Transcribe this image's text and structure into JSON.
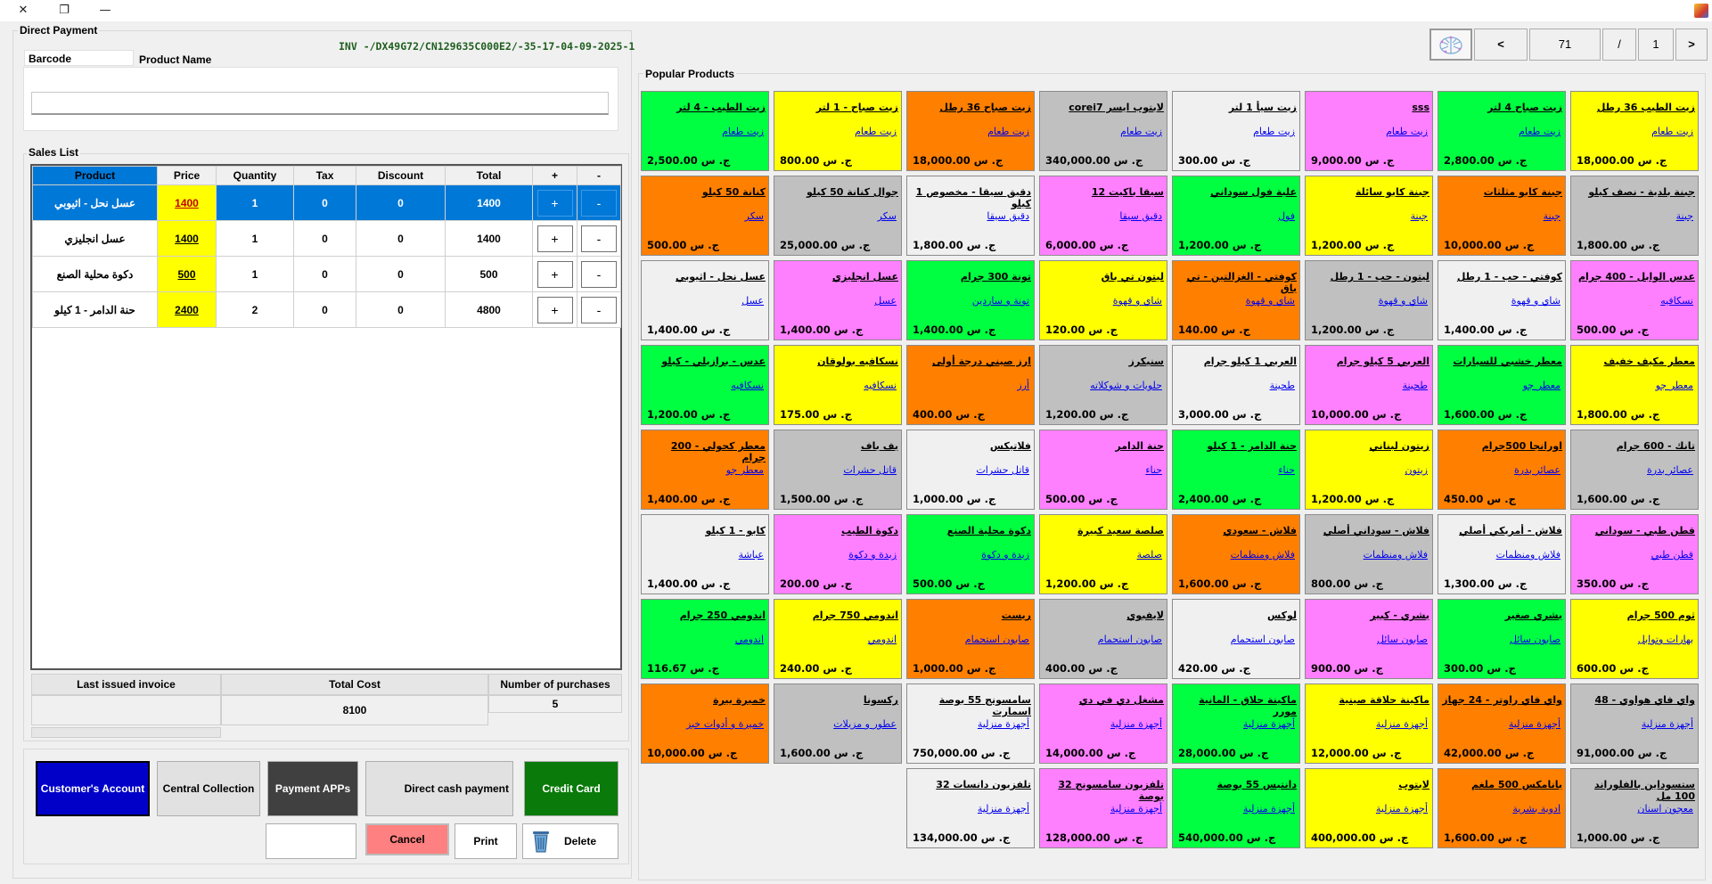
{
  "window": {
    "close_glyph": "✕",
    "restore_glyph": "❐",
    "minimize_glyph": "—"
  },
  "frame_title": "Direct Payment",
  "invoice_code": "INV -/DX49G72/CN129635C000E2/-35-17-04-09-2025-1",
  "tabs": {
    "barcode": "Barcode",
    "product_name": "Product Name"
  },
  "search": {
    "value": "",
    "placeholder": ""
  },
  "sales_list": {
    "title": "Sales List",
    "columns": [
      "Product",
      "Price",
      "Quantity",
      "Tax",
      "Discount",
      "Total",
      "+",
      "-"
    ],
    "rows": [
      {
        "product": "عسل نحل - اثيوبي",
        "price": "1400",
        "quantity": "1",
        "tax": "0",
        "discount": "0",
        "total": "1400",
        "plus": "+",
        "minus": "-"
      },
      {
        "product": "عسل انجليزي",
        "price": "1400",
        "quantity": "1",
        "tax": "0",
        "discount": "0",
        "total": "1400",
        "plus": "+",
        "minus": "-"
      },
      {
        "product": "دكوة محلية الصنع",
        "price": "500",
        "quantity": "1",
        "tax": "0",
        "discount": "0",
        "total": "500",
        "plus": "+",
        "minus": "-"
      },
      {
        "product": "حنة الدامر - 1 كيلو",
        "price": "2400",
        "quantity": "2",
        "tax": "0",
        "discount": "0",
        "total": "4800",
        "plus": "+",
        "minus": "-"
      }
    ]
  },
  "summary": {
    "last_invoice_label": "Last issued invoice",
    "last_invoice_value": "",
    "total_cost_label": "Total Cost",
    "total_cost_value": "8100",
    "purchases_label": "Number of purchases",
    "purchases_value": "5"
  },
  "buttons": {
    "customers_account": "Customer's Account",
    "central_collection": "Central Collection",
    "payment_apps": "Payment APPs",
    "direct_cash": "Direct cash payment",
    "credit_card": "Credit Card",
    "blank": "",
    "cancel": "Cancel",
    "print": "Print",
    "delete": "Delete"
  },
  "colors": {
    "selected": "#0078d7",
    "customers_account": "#0000c8",
    "payment_apps": "#404040",
    "credit_card": "#0a7a0a",
    "cancel": "#ff8080",
    "price_cell": "#ffff00"
  },
  "pager": {
    "prev": "<",
    "total": "71",
    "separator": "/",
    "current": "1",
    "next": ">",
    "logo_icon": "brain-icon"
  },
  "popular": {
    "title": "Popular Products",
    "products": [
      {
        "name": "زيت الطيب 36 رطل",
        "category": "زيت طعام",
        "price": "18,000.00 ج. س",
        "color": "#ffff00"
      },
      {
        "name": "زيت صباح 4 لتر",
        "category": "زيت طعام",
        "price": "2,800.00 ج. س",
        "color": "#00ff40"
      },
      {
        "name": "sss",
        "category": "زيت طعام",
        "price": "9,000.00 ج. س",
        "color": "#ff80ff"
      },
      {
        "name": "زيت سيأ 1 لتر",
        "category": "زيت طعام",
        "price": "300.00 ج. س",
        "color": "#f0f0f0"
      },
      {
        "name": "لابتوب ايسر corei7",
        "category": "زيت طعام",
        "price": "340,000.00 ج. س",
        "color": "#c0c0c0"
      },
      {
        "name": "زيت صباح 36 رطل",
        "category": "زيت طعام",
        "price": "18,000.00 ج. س",
        "color": "#ff8000"
      },
      {
        "name": "زيت صباح - 1 لتر",
        "category": "زيت طعام",
        "price": "800.00 ج. س",
        "color": "#ffff00"
      },
      {
        "name": "زيت الطيب - 4 لتر",
        "category": "زيت طعام",
        "price": "2,500.00 ج. س",
        "color": "#00ff40"
      },
      {
        "name": "جبنة بلدية - نصف كيلو",
        "category": "جبنة",
        "price": "1,800.00 ج. س",
        "color": "#c0c0c0"
      },
      {
        "name": "جبنة كابو مثلثات",
        "category": "جبنة",
        "price": "10,000.00 ج. س",
        "color": "#ff8000"
      },
      {
        "name": "جبنة كابو سائلة",
        "category": "جبنة",
        "price": "1,200.00 ج. س",
        "color": "#ffff00"
      },
      {
        "name": "علبة فول سوداني",
        "category": "فول",
        "price": "1,200.00 ج. س",
        "color": "#00ff40"
      },
      {
        "name": "سيقا باكيت 12",
        "category": "دقيق سيقا",
        "price": "6,000.00 ج. س",
        "color": "#ff80ff"
      },
      {
        "name": "دقيق سيقا - مخصوص 1 كيلو",
        "category": "دقيق سيقا",
        "price": "1,800.00 ج. س",
        "color": "#f0f0f0"
      },
      {
        "name": "جوال كنانة 50 كيلو",
        "category": "سكر",
        "price": "25,000.00 ج. س",
        "color": "#c0c0c0"
      },
      {
        "name": "كنانة 50 كيلو",
        "category": "سكر",
        "price": "500.00 ج. س",
        "color": "#ff8000"
      },
      {
        "name": "عدس الوابل - 400 جرام",
        "category": "نسكافيه",
        "price": "500.00 ج. س",
        "color": "#ff80ff"
      },
      {
        "name": "كوفتي - حب - 1 رطل",
        "category": "شاي و قهوة",
        "price": "1,400.00 ج. س",
        "color": "#f0f0f0"
      },
      {
        "name": "ليتون - حب - 1 رطل",
        "category": "شاي و قهوة",
        "price": "1,200.00 ج. س",
        "color": "#c0c0c0"
      },
      {
        "name": "كوفتي - الغزالتين - تي باق",
        "category": "شاي و قهوة",
        "price": "140.00 ج. س",
        "color": "#ff8000"
      },
      {
        "name": "ليتون تي باق",
        "category": "شاي و قهوة",
        "price": "120.00 ج. س",
        "color": "#ffff00"
      },
      {
        "name": "تونة 300 جرام",
        "category": "تونة و ساردين",
        "price": "1,400.00 ج. س",
        "color": "#00ff40"
      },
      {
        "name": "عسل انجليزي",
        "category": "عسل",
        "price": "1,400.00 ج. س",
        "color": "#ff80ff"
      },
      {
        "name": "عسل نحل - اثيوبي",
        "category": "عسل",
        "price": "1,400.00 ج. س",
        "color": "#f0f0f0"
      },
      {
        "name": "معطر مكيف خفيف",
        "category": "معطر جو",
        "price": "1,800.00 ج. س",
        "color": "#ffff00"
      },
      {
        "name": "معطر خشبي للسيارات",
        "category": "معطر جو",
        "price": "1,600.00 ج. س",
        "color": "#00ff40"
      },
      {
        "name": "العربي 5 كيلو جرام",
        "category": "طحينة",
        "price": "10,000.00 ج. س",
        "color": "#ff80ff"
      },
      {
        "name": "العربي 1 كيلو جرام",
        "category": "طحينة",
        "price": "3,000.00 ج. س",
        "color": "#f0f0f0"
      },
      {
        "name": "سنيكرز",
        "category": "حلويات و شوكلاته",
        "price": "1,200.00 ج. س",
        "color": "#c0c0c0"
      },
      {
        "name": "ارز صيني درجة أولى",
        "category": "أرز",
        "price": "400.00 ج. س",
        "color": "#ff8000"
      },
      {
        "name": "نسكافيه بولوقان",
        "category": "نسكافيه",
        "price": "175.00 ج. س",
        "color": "#ffff00"
      },
      {
        "name": "عدس - برازيلي - كيلو",
        "category": "نسكافيه",
        "price": "1,200.00 ج. س",
        "color": "#00ff40"
      },
      {
        "name": "تانك - 600 جرام",
        "category": "عصائر بدرة",
        "price": "1,600.00 ج. س",
        "color": "#c0c0c0"
      },
      {
        "name": "اورانجا 500جرام",
        "category": "عصائر بدرة",
        "price": "450.00 ج. س",
        "color": "#ff8000"
      },
      {
        "name": "زيتون لبناني",
        "category": "زيتون",
        "price": "1,200.00 ج. س",
        "color": "#ffff00"
      },
      {
        "name": "حنة الدامر - 1 كيلو",
        "category": "حناء",
        "price": "2,400.00 ج. س",
        "color": "#00ff40"
      },
      {
        "name": "حنة الدامر",
        "category": "حناء",
        "price": "500.00 ج. س",
        "color": "#ff80ff"
      },
      {
        "name": "فلاتيكس",
        "category": "قاتل حشرات",
        "price": "1,000.00 ج. س",
        "color": "#f0f0f0"
      },
      {
        "name": "بف باف",
        "category": "قاتل حشرات",
        "price": "1,500.00 ج. س",
        "color": "#c0c0c0"
      },
      {
        "name": "معطر كحولي - 200 جرام",
        "category": "معطر جو",
        "price": "1,400.00 ج. س",
        "color": "#ff8000"
      },
      {
        "name": "قطن طبي - سوداني",
        "category": "قطن طبي",
        "price": "350.00 ج. س",
        "color": "#ff80ff"
      },
      {
        "name": "فلاش - أمريكي أصلي",
        "category": "فلاش ومنظمات",
        "price": "1,300.00 ج. س",
        "color": "#f0f0f0"
      },
      {
        "name": "فلاش - سوداني أصلي",
        "category": "فلاش ومنظمات",
        "price": "800.00 ج. س",
        "color": "#c0c0c0"
      },
      {
        "name": "فلاش - سعودي",
        "category": "فلاش ومنظمات",
        "price": "1,600.00 ج. س",
        "color": "#ff8000"
      },
      {
        "name": "صلصة سعيد كبيرة",
        "category": "صلصة",
        "price": "1,200.00 ج. س",
        "color": "#ffff00"
      },
      {
        "name": "دكوة محلية الصنع",
        "category": "زبدة و دكوة",
        "price": "500.00 ج. س",
        "color": "#00ff40"
      },
      {
        "name": "دكوة الطيب",
        "category": "زبدة و دكوة",
        "price": "200.00 ج. س",
        "color": "#ff80ff"
      },
      {
        "name": "كابو - 1 كيلو",
        "category": "عباشة",
        "price": "1,400.00 ج. س",
        "color": "#f0f0f0"
      },
      {
        "name": "ثوم 500 جرام",
        "category": "بهارات وتوابل",
        "price": "600.00 ج. س",
        "color": "#ffff00"
      },
      {
        "name": "بشري صغير",
        "category": "صابون سائل",
        "price": "300.00 ج. س",
        "color": "#00ff40"
      },
      {
        "name": "بشري - كبير",
        "category": "صابون سائل",
        "price": "900.00 ج. س",
        "color": "#ff80ff"
      },
      {
        "name": "لوكس",
        "category": "صابون استحمام",
        "price": "420.00 ج. س",
        "color": "#f0f0f0"
      },
      {
        "name": "لايفبوي",
        "category": "صابون استحمام",
        "price": "400.00 ج. س",
        "color": "#c0c0c0"
      },
      {
        "name": "ريست",
        "category": "صابون استحمام",
        "price": "1,000.00 ج. س",
        "color": "#ff8000"
      },
      {
        "name": "اندومي 750 جرام",
        "category": "اندومي",
        "price": "240.00 ج. س",
        "color": "#ffff00"
      },
      {
        "name": "اندومي 250 جرام",
        "category": "اندومي",
        "price": "116.67 ج. س",
        "color": "#00ff40"
      },
      {
        "name": "واي فاي هواوي - 48",
        "category": "أجهزة منزلية",
        "price": "91,000.00 ج. س",
        "color": "#c0c0c0"
      },
      {
        "name": "واي فاي راوتر - 24 جهاز",
        "category": "أجهزة منزلية",
        "price": "42,000.00 ج. س",
        "color": "#ff8000"
      },
      {
        "name": "ماكينة حلاقة صينية",
        "category": "أجهزة منزلية",
        "price": "12,000.00 ج. س",
        "color": "#ffff00"
      },
      {
        "name": "ماكينة حلاق - المانية مورر",
        "category": "أجهزة منزلية",
        "price": "28,000.00 ج. س",
        "color": "#00ff40"
      },
      {
        "name": "مشغل دي في دي",
        "category": "أجهزة منزلية",
        "price": "14,000.00 ج. س",
        "color": "#ff80ff"
      },
      {
        "name": "سامسونج 55 بوصة اسمارت",
        "category": "أجهزة منزلية",
        "price": "750,000.00 ج. س",
        "color": "#f0f0f0"
      },
      {
        "name": "ركسونا",
        "category": "عطور و مزيلات",
        "price": "1,600.00 ج. س",
        "color": "#c0c0c0"
      },
      {
        "name": "خميرة بيرة",
        "category": "خميرة و أدوات خبز",
        "price": "10,000.00 ج. س",
        "color": "#ff8000"
      },
      {
        "name": "ستسوداين بالفلوراند 100 مل",
        "category": "معجون اسنان",
        "price": "1,000.00 ج. س",
        "color": "#c0c0c0"
      },
      {
        "name": "بانامكس 500 ملغم",
        "category": "ادوية بشرية",
        "price": "1,600.00 ج. س",
        "color": "#ff8000"
      },
      {
        "name": "لابتوب",
        "category": "أجهزة منزلية",
        "price": "400,000.00 ج. س",
        "color": "#ffff00"
      },
      {
        "name": "دانتيس 55 بوصة",
        "category": "أجهزة منزلية",
        "price": "540,000.00 ج. س",
        "color": "#00ff40"
      },
      {
        "name": "تلفزيون سامسونج 32 بوصة",
        "category": "أجهزة منزلية",
        "price": "128,000.00 ج. س",
        "color": "#ff80ff"
      },
      {
        "name": "تلفزيون دانسات 32",
        "category": "أجهزة منزلية",
        "price": "134,000.00 ج. س",
        "color": "#f0f0f0"
      }
    ]
  }
}
